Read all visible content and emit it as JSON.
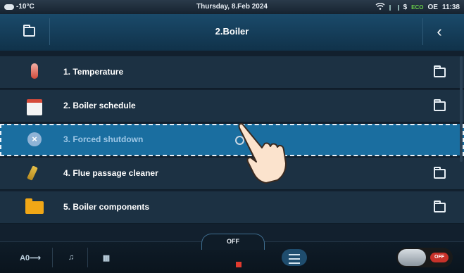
{
  "status_bar": {
    "temperature": "-10°C",
    "date": "Thursday, 8.Feb 2024",
    "eco_label": "ECO",
    "mode": "OE",
    "time": "11:38"
  },
  "header": {
    "title": "2.Boiler"
  },
  "menu": {
    "items": [
      {
        "label": "1.  Temperature",
        "icon": "thermometer-icon",
        "has_folder": true
      },
      {
        "label": "2.  Boiler schedule",
        "icon": "calendar-icon",
        "has_folder": true
      },
      {
        "label": "3.  Forced shutdown",
        "icon": "stop-icon",
        "selected": true
      },
      {
        "label": "4.  Flue passage cleaner",
        "icon": "broom-icon",
        "has_folder": true
      },
      {
        "label": "5.  Boiler components",
        "icon": "folder-icon",
        "has_folder": true
      }
    ]
  },
  "bottom_bar": {
    "off_label": "OFF",
    "toggle_label": "OFF"
  }
}
